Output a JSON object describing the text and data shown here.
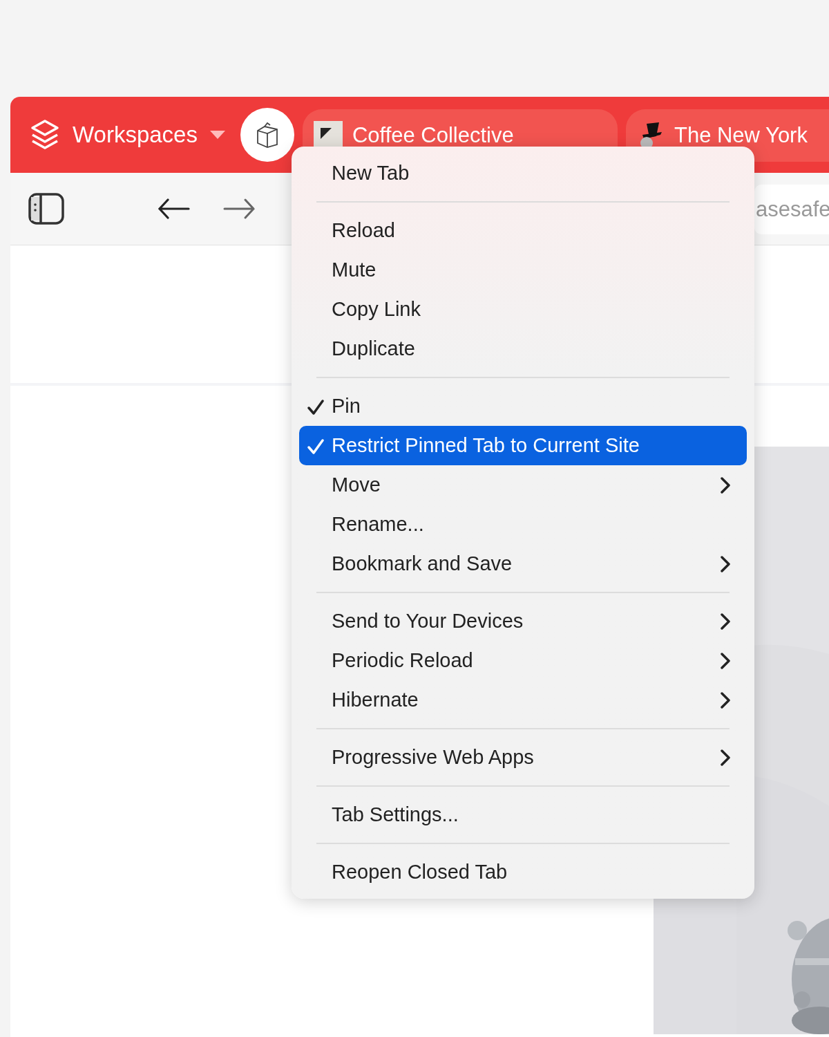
{
  "tab_bar": {
    "workspaces": {
      "label": "Workspaces"
    },
    "tabs": [
      {
        "kind": "pinned",
        "selected": true
      },
      {
        "kind": "normal",
        "title": "Coffee Collective",
        "selected": false
      },
      {
        "kind": "normal",
        "title": "The New York",
        "selected": false
      }
    ]
  },
  "toolbar": {
    "address": "asesafe"
  },
  "context_menu": {
    "items": [
      {
        "kind": "item",
        "label": "New Tab",
        "checked": false,
        "selected": false,
        "submenu": false
      },
      {
        "kind": "separator"
      },
      {
        "kind": "item",
        "label": "Reload",
        "checked": false,
        "selected": false,
        "submenu": false
      },
      {
        "kind": "item",
        "label": "Mute",
        "checked": false,
        "selected": false,
        "submenu": false
      },
      {
        "kind": "item",
        "label": "Copy Link",
        "checked": false,
        "selected": false,
        "submenu": false
      },
      {
        "kind": "item",
        "label": "Duplicate",
        "checked": false,
        "selected": false,
        "submenu": false
      },
      {
        "kind": "separator"
      },
      {
        "kind": "item",
        "label": "Pin",
        "checked": true,
        "selected": false,
        "submenu": false
      },
      {
        "kind": "item",
        "label": "Restrict Pinned Tab to Current Site",
        "checked": true,
        "selected": true,
        "submenu": false
      },
      {
        "kind": "item",
        "label": "Move",
        "checked": false,
        "selected": false,
        "submenu": true
      },
      {
        "kind": "item",
        "label": "Rename...",
        "checked": false,
        "selected": false,
        "submenu": false
      },
      {
        "kind": "item",
        "label": "Bookmark and Save",
        "checked": false,
        "selected": false,
        "submenu": true
      },
      {
        "kind": "separator"
      },
      {
        "kind": "item",
        "label": "Send to Your Devices",
        "checked": false,
        "selected": false,
        "submenu": true
      },
      {
        "kind": "item",
        "label": "Periodic Reload",
        "checked": false,
        "selected": false,
        "submenu": true
      },
      {
        "kind": "item",
        "label": "Hibernate",
        "checked": false,
        "selected": false,
        "submenu": true
      },
      {
        "kind": "separator"
      },
      {
        "kind": "item",
        "label": "Progressive Web Apps",
        "checked": false,
        "selected": false,
        "submenu": true
      },
      {
        "kind": "separator"
      },
      {
        "kind": "item",
        "label": "Tab Settings...",
        "checked": false,
        "selected": false,
        "submenu": false
      },
      {
        "kind": "separator"
      },
      {
        "kind": "item",
        "label": "Reopen Closed Tab",
        "checked": false,
        "selected": false,
        "submenu": false
      }
    ]
  }
}
